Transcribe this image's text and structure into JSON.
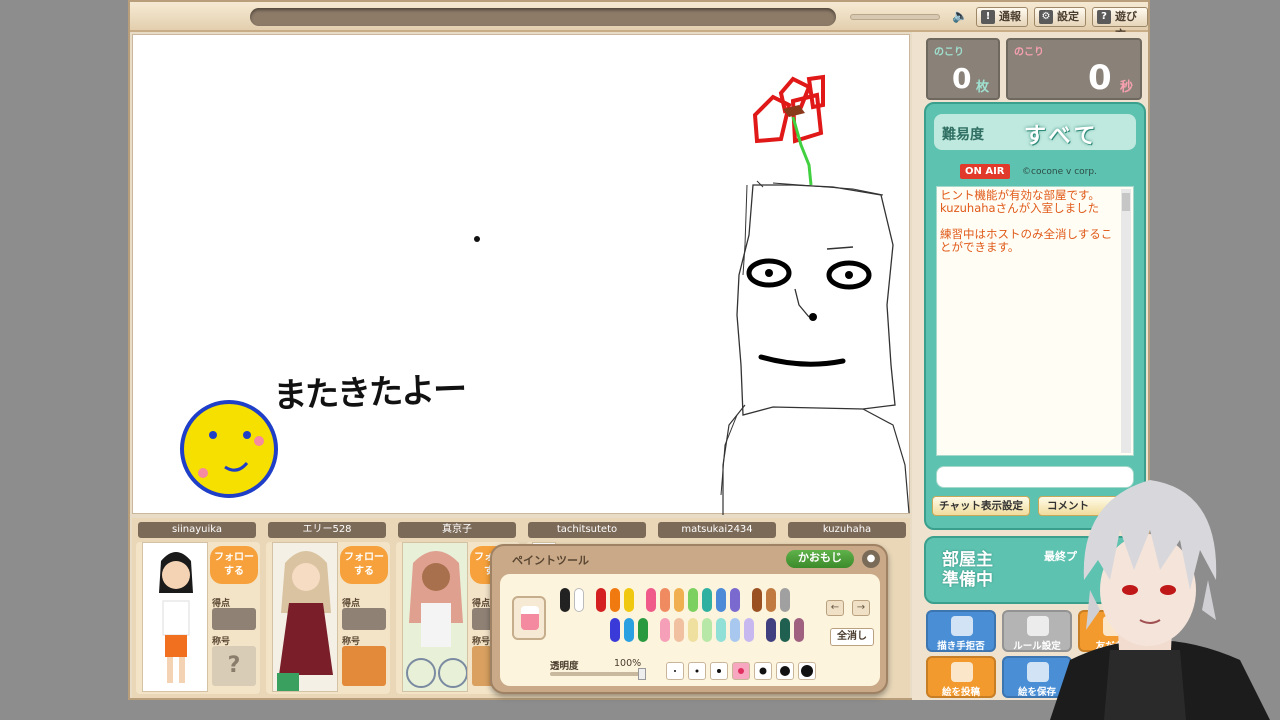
{
  "topbar": {
    "report_label": "通報",
    "settings_label": "設定",
    "howto_label": "遊び方"
  },
  "counters": {
    "cards_label": "のこり",
    "cards_value": "0",
    "cards_unit": "枚",
    "time_label": "のこり",
    "time_value": "0",
    "time_unit": "秒"
  },
  "chat": {
    "difficulty_label": "難易度",
    "difficulty_value": "すべて",
    "onair_label": "ON AIR",
    "copyright": "©cocone v corp.",
    "messages": [
      "ヒント機能が有効な部屋です。",
      "kuzuhahaさんが入室しました",
      "",
      "練習中はホストのみ全消しすることができます。"
    ],
    "display_settings_label": "チャット表示設定",
    "comment_label": "コメント"
  },
  "host_status": {
    "main": "部屋主\n準備中",
    "side": "最終プ"
  },
  "actions": [
    {
      "label": "描き手拒否",
      "color": "#4a8fd6"
    },
    {
      "label": "ルール設定",
      "color": "#b4b4b4"
    },
    {
      "label": "友だち",
      "color": "#f39a2e"
    },
    {
      "label": "絵を投稿",
      "color": "#f39a2e"
    },
    {
      "label": "絵を保存",
      "color": "#4a8fd6"
    }
  ],
  "players": [
    {
      "name": "siinayuika",
      "follow": "フォロー\nする",
      "score_label": "得点",
      "rank_label": "称号",
      "rank_value": "?"
    },
    {
      "name": "エリー528",
      "follow": "フォロー\nする",
      "score_label": "得点",
      "rank_label": "称号",
      "rank_value": ""
    },
    {
      "name": "真京子",
      "follow": "フォロー\nする",
      "score_label": "得点",
      "rank_label": "称号",
      "rank_value": ""
    },
    {
      "name": "tachitsuteto"
    },
    {
      "name": "matsukai2434"
    },
    {
      "name": "kuzuhaha"
    }
  ],
  "painttool": {
    "title": "ペイントツール",
    "kaomoji_label": "かおもじ",
    "clear_all_label": "全消し",
    "opacity_label": "透明度",
    "opacity_value": "100%",
    "colors_top": [
      "#222222",
      "#ffffff",
      "#d42020",
      "#f07a10",
      "#f0c810",
      "#ef5a8a",
      "#f08a60",
      "#f0b050",
      "#7cd060",
      "#30b0a0",
      "#4c8ad8",
      "#7a6ad0",
      "#9a5020",
      "#c07a40",
      "#a0a0a0"
    ],
    "colors_bottom": [
      "#3a3ad8",
      "#2aa0e0",
      "#2a9a40",
      "#f5a0b8",
      "#f0c0a0",
      "#f0e0a0",
      "#b8e8a8",
      "#90e0d8",
      "#a8c8f0",
      "#c8b8f0",
      "#404080",
      "#206050",
      "#a06080"
    ]
  },
  "canvas": {
    "handwriting": "またきたよー"
  }
}
